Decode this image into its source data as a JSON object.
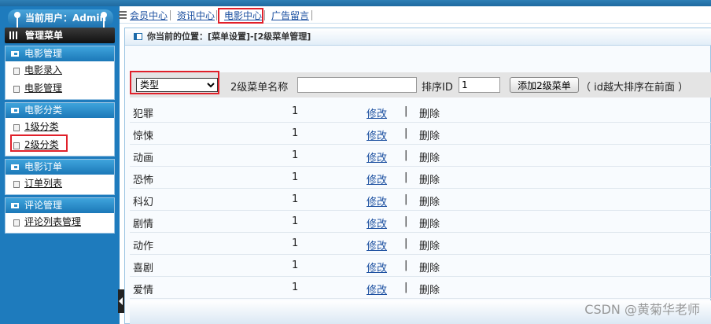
{
  "user": {
    "label": "当前用户：Admin"
  },
  "menu": {
    "title": "管理菜单",
    "groups": [
      {
        "title": "电影管理",
        "items": [
          "电影录入",
          "电影管理"
        ]
      },
      {
        "title": "电影分类",
        "items": [
          "1级分类",
          "2级分类"
        ]
      },
      {
        "title": "电影订单",
        "items": [
          "订单列表"
        ]
      },
      {
        "title": "评论管理",
        "items": [
          "评论列表管理"
        ]
      }
    ]
  },
  "nav": {
    "items": [
      "会员中心",
      "资讯中心",
      "电影中心",
      "广告留言"
    ]
  },
  "breadcrumb": {
    "text": "你当前的位置：[菜单设置]-[2级菜单管理]"
  },
  "form": {
    "type_selected": "类型",
    "name_label": "2级菜单名称",
    "name_value": "",
    "sort_label": "排序ID",
    "sort_value": "1",
    "add_button": "添加2级菜单",
    "hint": "（ id越大排序在前面 ）"
  },
  "table": {
    "edit_label": "修改",
    "separator": "|",
    "delete_label": "删除",
    "rows": [
      {
        "name": "犯罪",
        "sort": "1"
      },
      {
        "name": "惊悚",
        "sort": "1"
      },
      {
        "name": "动画",
        "sort": "1"
      },
      {
        "name": "恐怖",
        "sort": "1"
      },
      {
        "name": "科幻",
        "sort": "1"
      },
      {
        "name": "剧情",
        "sort": "1"
      },
      {
        "name": "动作",
        "sort": "1"
      },
      {
        "name": "喜剧",
        "sort": "1"
      },
      {
        "name": "爱情",
        "sort": "1"
      }
    ]
  },
  "watermark": "CSDN @黄菊华老师",
  "colors": {
    "highlight_border": "#e0202a",
    "sidebar_bg": "#1e7bbd",
    "link": "#1b4fa0"
  }
}
